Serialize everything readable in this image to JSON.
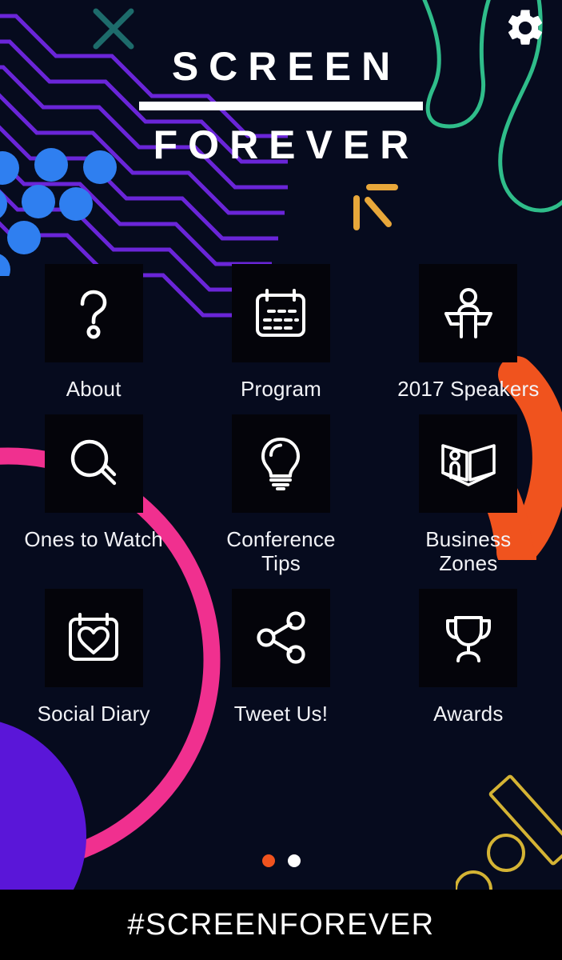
{
  "app": {
    "background_color": "#060b1e",
    "tile_color": "#04040a"
  },
  "header": {
    "settings_icon": "gear-icon",
    "close_icon": "x-icon",
    "brand_line_1": "SCREEN",
    "brand_line_2": "FOREVER"
  },
  "menu": {
    "items": [
      {
        "label": "About",
        "icon": "question-mark-icon"
      },
      {
        "label": "Program",
        "icon": "calendar-icon"
      },
      {
        "label": "2017 Speakers",
        "icon": "speaker-podium-icon"
      },
      {
        "label": "Ones to Watch",
        "icon": "magnifying-glass-icon"
      },
      {
        "label": "Conference\nTips",
        "icon": "lightbulb-icon"
      },
      {
        "label": "Business\nZones",
        "icon": "exhibition-booth-icon"
      },
      {
        "label": "Social Diary",
        "icon": "calendar-heart-icon"
      },
      {
        "label": "Tweet Us!",
        "icon": "share-icon"
      },
      {
        "label": "Awards",
        "icon": "trophy-icon"
      }
    ]
  },
  "pager": {
    "total_pages": 2,
    "current_page": 1,
    "active_color": "#f0531e",
    "inactive_color": "#ffffff"
  },
  "footer": {
    "hashtag": "#SCREENFOREVER",
    "background_color": "#000000"
  },
  "decorations": {
    "zigzag_color": "#6a25d8",
    "dot_color": "#2f7ff0",
    "green_curve_color": "#2fbd8a",
    "orange_stroke_color": "#f0531e",
    "pink_ring_color": "#f0308f",
    "purple_circle_color": "#5a16d8",
    "yellow_shape_color": "#d4b334",
    "amber_tick_color": "#e8a73a",
    "teal_x_color": "#1d6b6b"
  }
}
